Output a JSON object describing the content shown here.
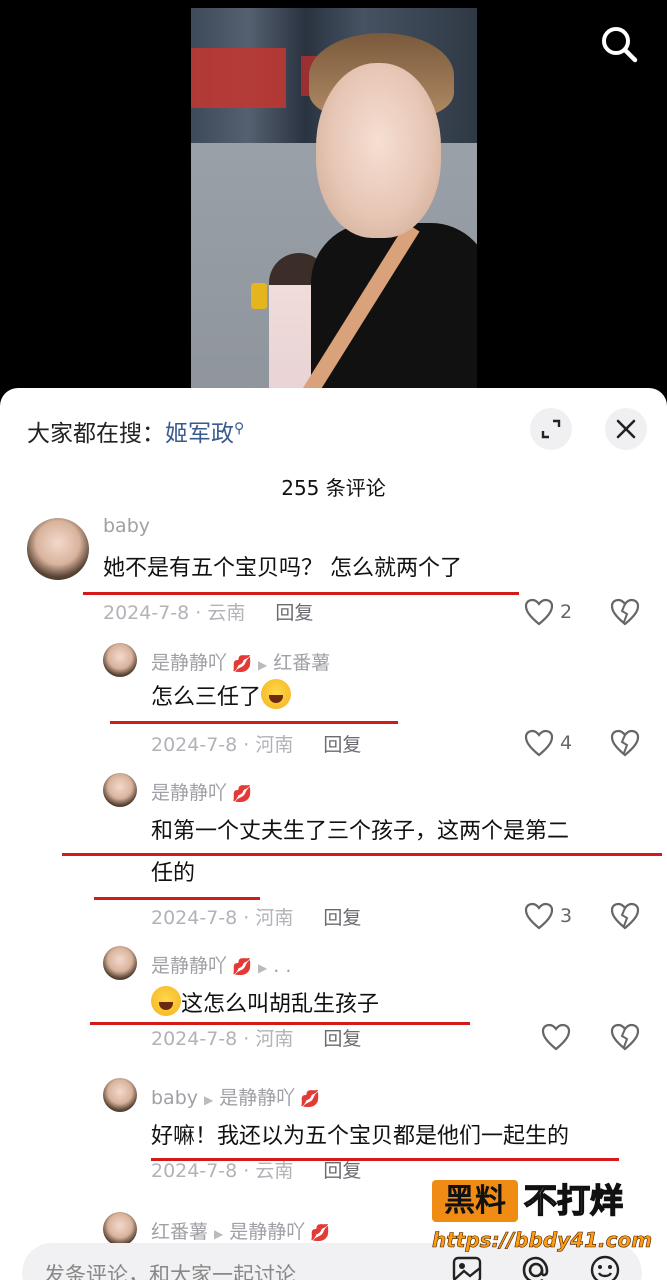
{
  "hot_search": {
    "prefix": "大家都在搜：",
    "keyword": "姬军政"
  },
  "comment_count": "255 条评论",
  "comments": [
    {
      "user": "baby",
      "reply_to": "",
      "text": "她不是有五个宝贝吗？ 怎么就两个了",
      "date": "2024-7-8 · 云南",
      "reply": "回复",
      "likes": "2"
    },
    {
      "user": "是静静吖",
      "reply_to": "红番薯",
      "text": "怎么三任了",
      "date": "2024-7-8 · 河南",
      "reply": "回复",
      "likes": "4"
    },
    {
      "user": "是静静吖",
      "reply_to": "",
      "text_line1": "和第一个丈夫生了三个孩子，这两个是第二",
      "text_line2": "任的",
      "date": "2024-7-8 · 河南",
      "reply": "回复",
      "likes": "3"
    },
    {
      "user": "是静静吖",
      "reply_to": ". .",
      "text": "这怎么叫胡乱生孩子",
      "date": "2024-7-8 · 河南",
      "reply": "回复",
      "likes": ""
    },
    {
      "user": "baby",
      "reply_to": "是静静吖",
      "text": "好嘛！我还以为五个宝贝都是他们一起生的",
      "date": "2024-7-8 · 云南",
      "reply": "回复",
      "likes": ""
    },
    {
      "user": "红番薯",
      "reply_to": "是静静吖"
    }
  ],
  "input": {
    "placeholder": "发条评论，和大家一起讨论"
  },
  "watermark": {
    "box": "黑料",
    "big": "不打烊",
    "url": "https://bbdy41.com"
  },
  "colors": {
    "underline": "#d41919",
    "keyword": "#3a5a8f",
    "watermark_orange": "#f08c14"
  },
  "icons": [
    "search-icon",
    "expand-icon",
    "close-icon",
    "heart-icon",
    "broken-heart-icon",
    "image-icon",
    "at-icon",
    "emoji-icon"
  ]
}
